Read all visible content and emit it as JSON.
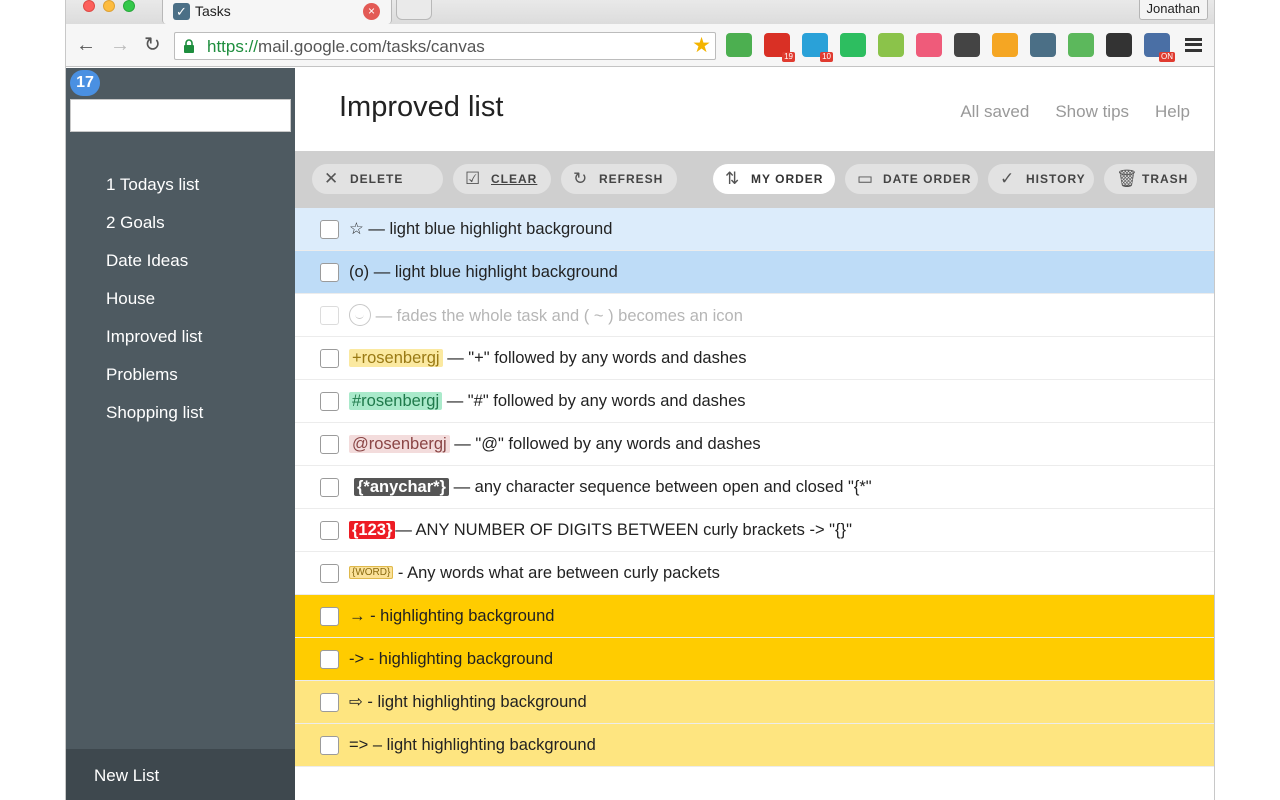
{
  "browser": {
    "tab_title": "Tasks",
    "tab_close": "×",
    "profile_name": "Jonathan",
    "url_scheme": "https://",
    "url_rest": "mail.google.com/tasks/canvas",
    "back_icon": "←",
    "forward_icon": "→",
    "reload_icon": "↻",
    "star_icon": "★",
    "extensions": [
      {
        "name": "qr-icon",
        "color": "#4caf50",
        "badge": ""
      },
      {
        "name": "puzzle-red-icon",
        "color": "#d93025",
        "badge": "19"
      },
      {
        "name": "a-translate-icon",
        "color": "#2aa1d8",
        "badge": "10"
      },
      {
        "name": "evernote-icon",
        "color": "#2dbe60",
        "badge": ""
      },
      {
        "name": "check-list-icon",
        "color": "#8bc34a",
        "badge": ""
      },
      {
        "name": "cozy-icon",
        "color": "#ef5b7a",
        "badge": ""
      },
      {
        "name": "pocket-icon",
        "color": "#444444",
        "badge": ""
      },
      {
        "name": "chart-icon",
        "color": "#f5a623",
        "badge": ""
      },
      {
        "name": "tasks-check-icon",
        "color": "#4b6f86",
        "badge": ""
      },
      {
        "name": "green-clock-icon",
        "color": "#5cb85c",
        "badge": ""
      },
      {
        "name": "dark-arrow-icon",
        "color": "#333333",
        "badge": ""
      },
      {
        "name": "gear-on-icon",
        "color": "#4a6fa5",
        "badge": "ON"
      }
    ]
  },
  "sidebar": {
    "count": "17",
    "search_placeholder": "",
    "lists": [
      "1 Todays list",
      "2 Goals",
      "Date Ideas",
      "House",
      "Improved list",
      "Problems",
      "Shopping list"
    ],
    "new_list": "New List"
  },
  "header": {
    "title": "Improved list",
    "links": [
      "All saved",
      "Show tips",
      "Help"
    ]
  },
  "actions": {
    "delete": "DELETE",
    "clear": "CLEAR",
    "refresh": "REFRESH",
    "my_order": "MY ORDER",
    "date_order": "DATE ORDER",
    "history": "HISTORY",
    "trash": "TRASH"
  },
  "tasks": [
    {
      "prefix": "☆",
      "tag": "",
      "text": " — light blue highlight background"
    },
    {
      "prefix": "(o)",
      "tag": "",
      "text": " — light blue highlight background"
    },
    {
      "prefix": "",
      "tag": "",
      "text": " — fades the whole task and ( ~ ) becomes an icon"
    },
    {
      "prefix": "",
      "tag": "+rosenbergj",
      "text": " — \"+\" followed by any words and dashes"
    },
    {
      "prefix": "",
      "tag": "#rosenbergj",
      "text": " — \"#\" followed by any words and dashes"
    },
    {
      "prefix": "",
      "tag": "@rosenbergj",
      "text": " — \"@\" followed by any words and dashes"
    },
    {
      "prefix": "",
      "tag": "{*anychar*}",
      "text": " — any character sequence between open and closed \"{*\""
    },
    {
      "prefix": "",
      "tag": "{123}",
      "text": "— ANY NUMBER OF DIGITS BETWEEN  curly brackets -> \"{}\""
    },
    {
      "prefix": "",
      "tag": "{WORD}",
      "text": " - Any words what are between curly packets"
    },
    {
      "prefix": "→",
      "tag": "",
      "text": " -  highlighting background"
    },
    {
      "prefix": "->",
      "tag": "",
      "text": " -  highlighting background"
    },
    {
      "prefix": "⇨",
      "tag": "",
      "text": " - light highlighting background"
    },
    {
      "prefix": "=>",
      "tag": "",
      "text": " – light highlighting background"
    }
  ],
  "colors": {
    "sidebar": "#4e5a61",
    "light_blue": "#dcecfb",
    "blue": "#bedcf7",
    "orange": "#ffcc00",
    "light_yellow": "#fee580"
  }
}
